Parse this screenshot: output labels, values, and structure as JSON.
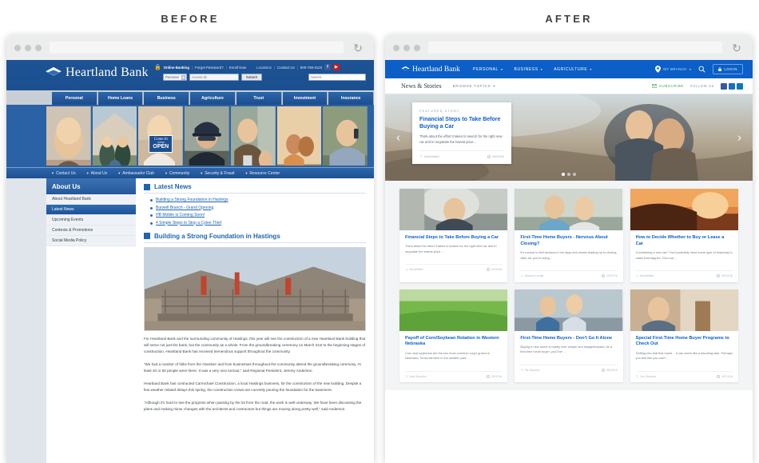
{
  "labels": {
    "before": "BEFORE",
    "after": "AFTER"
  },
  "before": {
    "logo": "Heartland Bank",
    "utility": {
      "online_banking": "Online Banking",
      "sep1": "|",
      "forgot": "Forgot Password?",
      "sep2": "|",
      "enroll": "Enroll Now",
      "locations": "Locations",
      "sep3": "|",
      "contact": "Contact Us",
      "sep4": "|",
      "phone": "800-759-3119",
      "facebook": "f",
      "youtube": "▶"
    },
    "login_form": {
      "account_type": "Personal",
      "access_id_placeholder": "Access ID",
      "submit": "Submit"
    },
    "search_placeholder": "Search...",
    "primary_nav": [
      "Personal",
      "Home Loans",
      "Business",
      "Agriculture",
      "Trust",
      "Investment",
      "Insurance"
    ],
    "secondary_nav": [
      "Contact Us",
      "About Us",
      "Ambassador Club",
      "Community",
      "Security & Fraud",
      "Resource Center"
    ],
    "hero_sign": {
      "script": "Come In",
      "small": "WE'RE",
      "big": "OPEN"
    },
    "sidebar": {
      "title": "About Us",
      "items": [
        {
          "label": "About Heartland Bank",
          "active": false
        },
        {
          "label": "Latest News",
          "active": true
        },
        {
          "label": "Upcoming Events",
          "active": false
        },
        {
          "label": "Contests & Promotions",
          "active": false
        },
        {
          "label": "Social Media Policy",
          "active": false
        }
      ]
    },
    "latest_news": {
      "heading": "Latest News",
      "links": [
        "Building a Strong Foundation in Hastings",
        "Burwell Branch - Grand Opening",
        "HB Mobile is Coming Soon!",
        "4 Simple Steps to Stop a Cyber Thief"
      ]
    },
    "article": {
      "heading": "Building a Strong Foundation in Hastings",
      "paragraphs": [
        "For Heartland Bank and the surrounding community of Hastings, this year will see the construction of a new Heartland Bank building that will serve not just the bank, but the community as a whole. From the groundbreaking ceremony on March 31st to the beginning stages of construction, Heartland Bank has received tremendous support throughout the community.",
        "“We had a number of folks from the chamber and from businesses throughout the community attend the groundbreaking ceremony. At least 40 or 50 people were there. It was a very nice turnout,” said Regional President, Jeremy Anderson.",
        "Heartland Bank has contracted Carmichael Construction, a local Hastings business, for the construction of the new building. Despite a few weather related delays this spring, the construction crews are currently pouring the foundation for the basement.",
        "“Although it’s hard to see the progress when passing by the lot from the road, the work is well underway. We have been discussing the plans and making minor changes with the architects and contractors but things are moving along pretty well,” said Anderson."
      ]
    }
  },
  "after": {
    "logo": "Heartland Bank",
    "primary_nav": [
      "PERSONAL",
      "BUSINESS",
      "AGRICULTURE"
    ],
    "my_branch": "MY BRANCH",
    "login": "LOGIN",
    "section_brand": "News & Stories",
    "browse_topics": "BROWSE TOPICS",
    "subscribe": "SUBSCRIBE",
    "follow_us": "FOLLOW US",
    "social": [
      "f",
      "▶",
      "in"
    ],
    "featured": {
      "kicker": "FEATURED STORY",
      "title": "Financial Steps to Take Before Buying a Car",
      "excerpt": "Think about the effort it takes to search for the right new car and to negotiate the lowest price...",
      "author": "NerdWallet",
      "date": "09/29/16"
    },
    "carousel": {
      "prev": "‹",
      "next": "›",
      "slides": 3,
      "active": 0
    },
    "cards": [
      {
        "title": "Financial Steps to Take Before Buying a Car",
        "excerpt": "Think about the effort it takes to search for the right new car and to negotiate the lowest price. ...",
        "author": "NerdWallet",
        "date": "09/29/16",
        "photo": "man-leaning-on-car"
      },
      {
        "title": "First-Time Home Buyers - Nervous About Closing?",
        "excerpt": "It's normal to feel anxious in the days and weeks leading up to closing. After all, you're doing ...",
        "author": "Deanna Lemke",
        "date": "09/27/16",
        "photo": "couple-with-keys"
      },
      {
        "title": "How to Decide Whether to Buy or Lease a Car",
        "excerpt": "Considering a new car? You'll probably need some type of financing to make that happen. Find out ...",
        "author": "NerdWallet",
        "date": "09/22/16",
        "photo": "car-interior-sunset"
      },
      {
        "title": "Payoff of Corn/Soybean Rotation in Western Nebraska",
        "excerpt": "Corn and soybeans are the two most common crops grown in Nebraska. Some farmers in the western part ...",
        "author": "Matt Stockton",
        "date": "09/21/16",
        "photo": "green-field"
      },
      {
        "title": "First-Time Home Buyers - Don't Go It Alone",
        "excerpt": "Buying a new home is hardly ever simple and straightforward. As a first-time home buyer, you'll be ...",
        "author": "Fili Sanchez",
        "date": "09/20/16",
        "photo": "family-walking"
      },
      {
        "title": "Special First-Time Home Buyer Programs to Check Out",
        "excerpt": "Getting into that first home -- it can seem like a daunting task. Perhaps you feel like you can't ...",
        "author": "Jen Stockton",
        "date": "09/13/16",
        "photo": "house-porch"
      }
    ]
  },
  "colors": {
    "before_blue": "#1f5496",
    "after_blue": "#0b5fc6",
    "link_blue": "#0b5fc6",
    "page_bg": "#f2f4f6"
  }
}
